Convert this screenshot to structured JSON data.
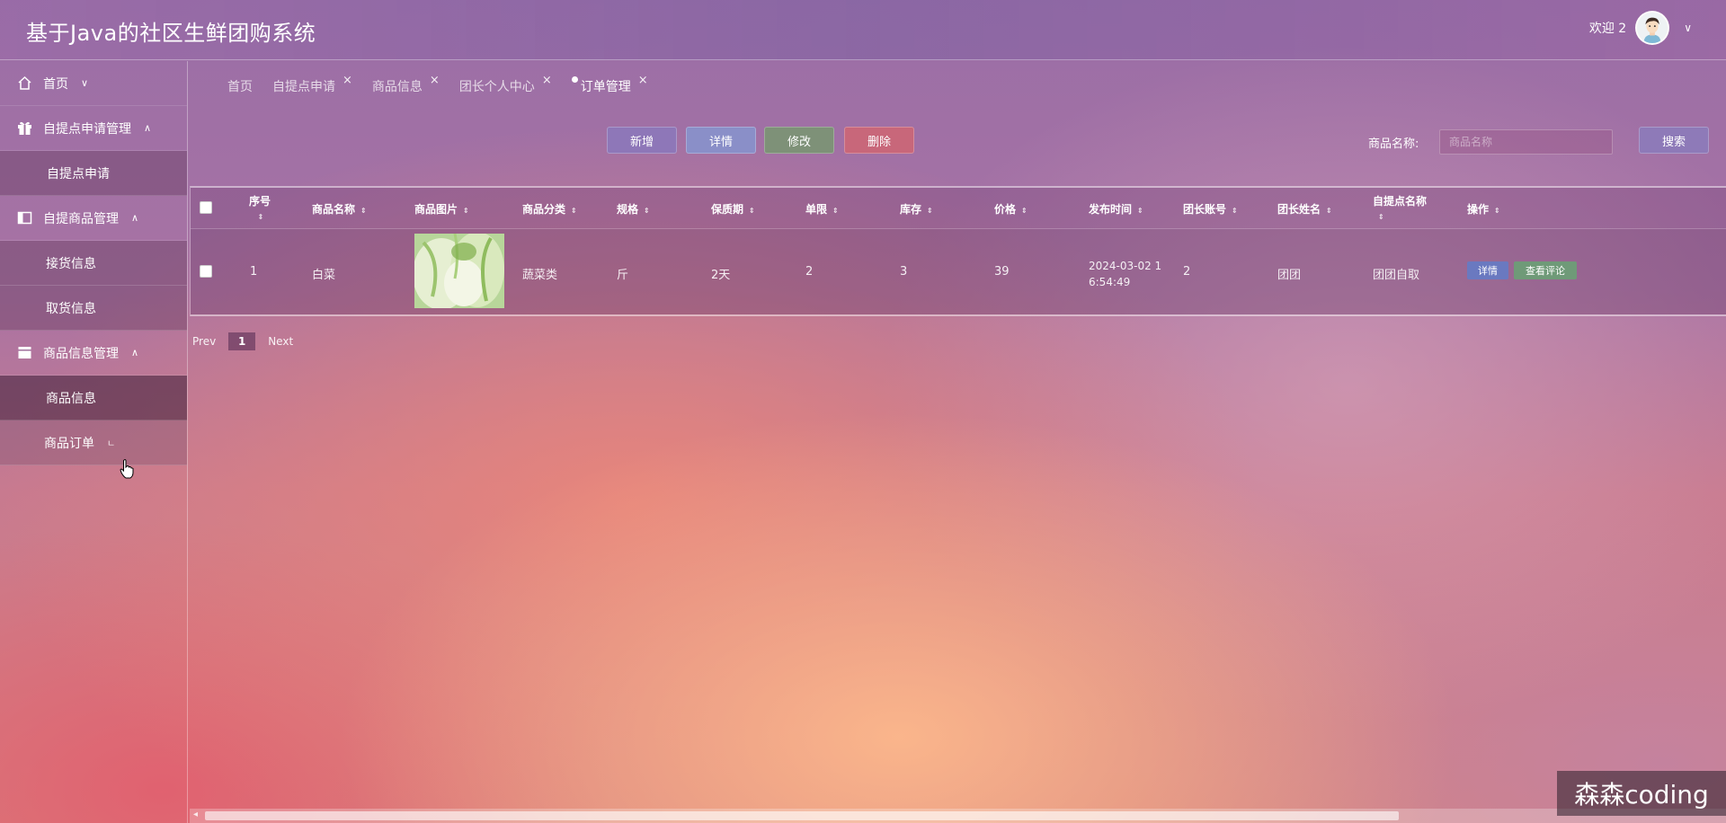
{
  "header": {
    "app_title": "基于Java的社区生鲜团购系统",
    "welcome": "欢迎 2",
    "avatar_icon": "user-avatar-icon",
    "dropdown_icon": "chevron-down-icon"
  },
  "sidebar": {
    "groups": [
      {
        "label": "首页",
        "icon": "home-icon",
        "caret": "∨"
      },
      {
        "label": "自提点申请管理",
        "icon": "gift-icon",
        "caret": "∧",
        "items": [
          "自提点申请"
        ]
      },
      {
        "label": "自提商品管理",
        "icon": "panel-icon",
        "caret": "∧",
        "items": [
          "接货信息",
          "取货信息"
        ]
      },
      {
        "label": "商品信息管理",
        "icon": "box-icon",
        "caret": "∧",
        "items": [
          "商品信息",
          "商品订单"
        ]
      }
    ],
    "hover_mark": "ㄴ"
  },
  "tabs": [
    {
      "label": "首页",
      "closable": false
    },
    {
      "label": "自提点申请",
      "closable": true
    },
    {
      "label": "商品信息",
      "closable": true
    },
    {
      "label": "团长个人中心",
      "closable": true
    },
    {
      "label": "订单管理",
      "closable": true,
      "active": true
    }
  ],
  "tab_close": "×",
  "toolbar": {
    "add": "新增",
    "detail": "详情",
    "edit": "修改",
    "delete": "删除",
    "colors": {
      "add": "#8e77b8",
      "detail": "#8a8fc8",
      "edit": "#7e9178",
      "delete": "#c8677a"
    }
  },
  "search": {
    "label": "商品名称:",
    "placeholder": "商品名称",
    "button": "搜索"
  },
  "table": {
    "headers": [
      "序号",
      "商品名称",
      "商品图片",
      "商品分类",
      "规格",
      "保质期",
      "单限",
      "库存",
      "价格",
      "发布时间",
      "团长账号",
      "团长姓名",
      "自提点名称",
      "操作"
    ],
    "rows": [
      {
        "index": "1",
        "name": "白菜",
        "image": "cabbage",
        "category": "蔬菜类",
        "spec": "斤",
        "shelf_life": "2天",
        "limit": "2",
        "stock": "3",
        "price": "39",
        "publish_time_line1": "2024-03-02 1",
        "publish_time_line2": "6:54:49",
        "leader_account": "2",
        "leader_name": "团团",
        "pickup_name": "团团自取",
        "op_detail": "详情",
        "op_review": "查看评论"
      }
    ]
  },
  "pager": {
    "prev": "Prev",
    "page": "1",
    "next": "Next"
  },
  "watermark": "森森coding"
}
